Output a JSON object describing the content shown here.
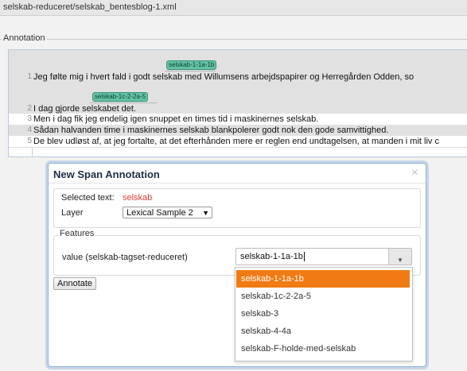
{
  "header": {
    "file_path": "selskab-reduceret/selskab_bentesblog-1.xml"
  },
  "annotation_panel": {
    "legend": "Annotation",
    "lines": [
      {
        "number": "1",
        "text": "Jeg følte mig i hvert fald i godt      selskab      med Willumsens arbejdspapirer og Herregården Odden, so",
        "chip": "selskab-1-1a-1b"
      },
      {
        "number": "2",
        "text": "I dag gjorde    selskabet    det.",
        "chip": "selskab-1c-2-2a-5"
      },
      {
        "number": "3",
        "text": "Men i dag fik jeg endelig igen snuppet en times tid i maskinernes selskab."
      },
      {
        "number": "4",
        "text": "Sådan halvanden time i maskinernes selskab blankpolerer godt nok den gode samvittighed."
      },
      {
        "number": "5",
        "text": "De blev udløst af, at jeg fortalte, at det efterhånden mere er reglen end undtagelsen, at manden i mit liv c"
      }
    ]
  },
  "dialog": {
    "title": "New Span Annotation",
    "close_glyph": "×",
    "selected_text_label": "Selected text:",
    "selected_text_value": "selskab",
    "layer_label": "Layer",
    "layer_value": "Lexical Sample 2",
    "layer_caret": "▼",
    "features_legend": "Features",
    "feature_label": "value (selskab-tagset-reduceret)",
    "feature_input_value": "selskab-1-1a-1b",
    "input_caret": "▼",
    "annotate_button": "Annotate",
    "dropdown_options": [
      "selskab-1-1a-1b",
      "selskab-1c-2-2a-5",
      "selskab-3",
      "selskab-4-4a",
      "selskab-F-holde-med-selskab"
    ],
    "selected_option_index": 0
  },
  "colors": {
    "chip_bg": "#64c2a6",
    "selected_option_bg": "#f07b14",
    "selected_text_color": "#e03a3a",
    "dialog_border": "#8fb3da"
  }
}
